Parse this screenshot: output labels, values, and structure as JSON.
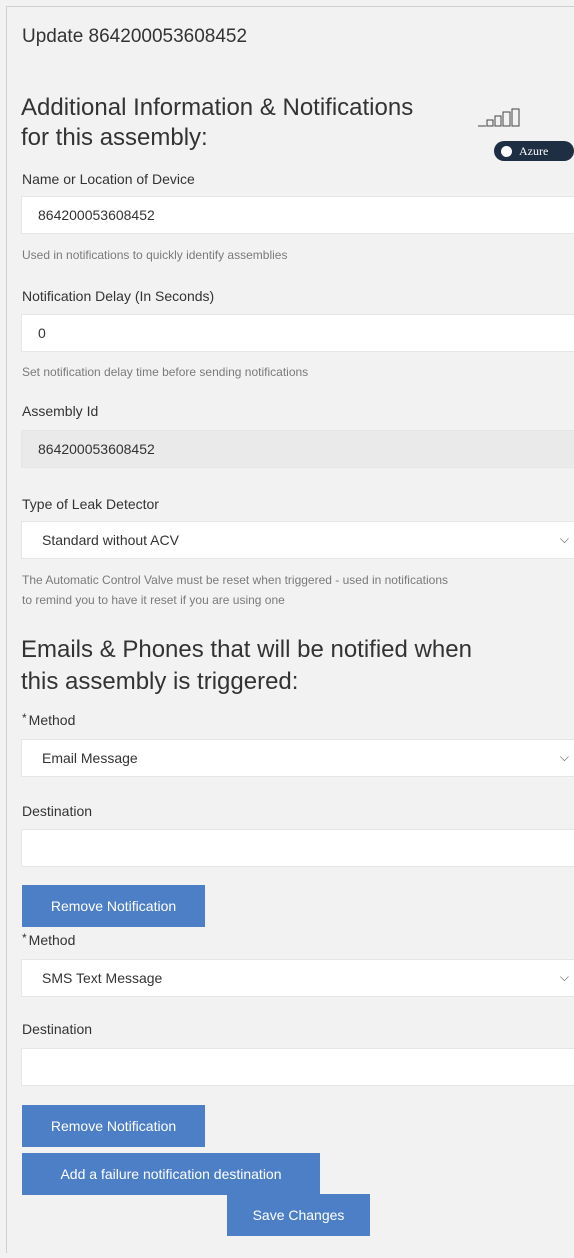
{
  "page": {
    "title": "Update 864200053608452"
  },
  "header": {
    "heading_line1": "Additional Information & Notifications",
    "heading_line2": "for this assembly:",
    "badge_label": "Azure"
  },
  "form": {
    "device_name": {
      "label": "Name or Location of Device",
      "value": "864200053608452",
      "help": "Used in notifications to quickly identify assemblies"
    },
    "notification_delay": {
      "label": "Notification Delay (In Seconds)",
      "value": "0",
      "help": "Set notification delay time before sending notifications"
    },
    "assembly_id": {
      "label": "Assembly Id",
      "value": "864200053608452"
    },
    "leak_detector": {
      "label": "Type of Leak Detector",
      "selected": "Standard without ACV",
      "help_line1": "The Automatic Control Valve must be reset when triggered - used in notifications",
      "help_line2": "to remind you to have it reset if you are using one"
    }
  },
  "notifications": {
    "heading_line1": "Emails & Phones that will be notified when",
    "heading_line2": "this assembly is triggered:",
    "items": [
      {
        "required_mark": "*",
        "method_label": "Method",
        "method_selected": "Email Message",
        "destination_label": "Destination",
        "destination_value": "",
        "remove_label": "Remove Notification"
      },
      {
        "required_mark": "*",
        "method_label": "Method",
        "method_selected": "SMS Text Message",
        "destination_label": "Destination",
        "destination_value": "",
        "remove_label": "Remove Notification"
      }
    ],
    "add_label": "Add a failure notification destination"
  },
  "actions": {
    "save_label": "Save Changes"
  },
  "icons": {
    "signal": "signal-bars-icon",
    "chevron": "chevron-down-icon",
    "toggle": "toggle-icon"
  },
  "colors": {
    "button": "#4d7fc7",
    "badge": "#1f2f43",
    "background": "#f2f2f2"
  }
}
